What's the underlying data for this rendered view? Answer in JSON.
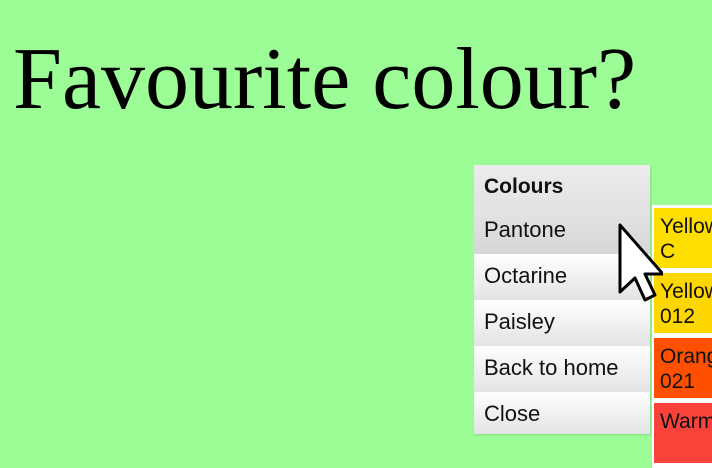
{
  "page": {
    "heading": "Favourite colour?"
  },
  "menu": {
    "header": "Colours",
    "items": [
      {
        "label": "Pantone",
        "active": true
      },
      {
        "label": "Octarine",
        "active": false
      },
      {
        "label": "Paisley",
        "active": false
      },
      {
        "label": "Back to home",
        "active": false
      },
      {
        "label": "Close",
        "active": false
      }
    ]
  },
  "submenu": {
    "swatches": [
      {
        "line1": "Yellow",
        "line2": "C",
        "color": "#fedd00"
      },
      {
        "line1": "Yellow",
        "line2": "012",
        "color": "#ffd700"
      },
      {
        "line1": "Orange",
        "line2": "021",
        "color": "#fe5000"
      },
      {
        "line1": "Warm",
        "line2": "",
        "color": "#f9423a"
      }
    ]
  },
  "colors": {
    "background": "#9cfd97"
  },
  "cursor": {
    "icon": "arrow-pointer-icon"
  }
}
